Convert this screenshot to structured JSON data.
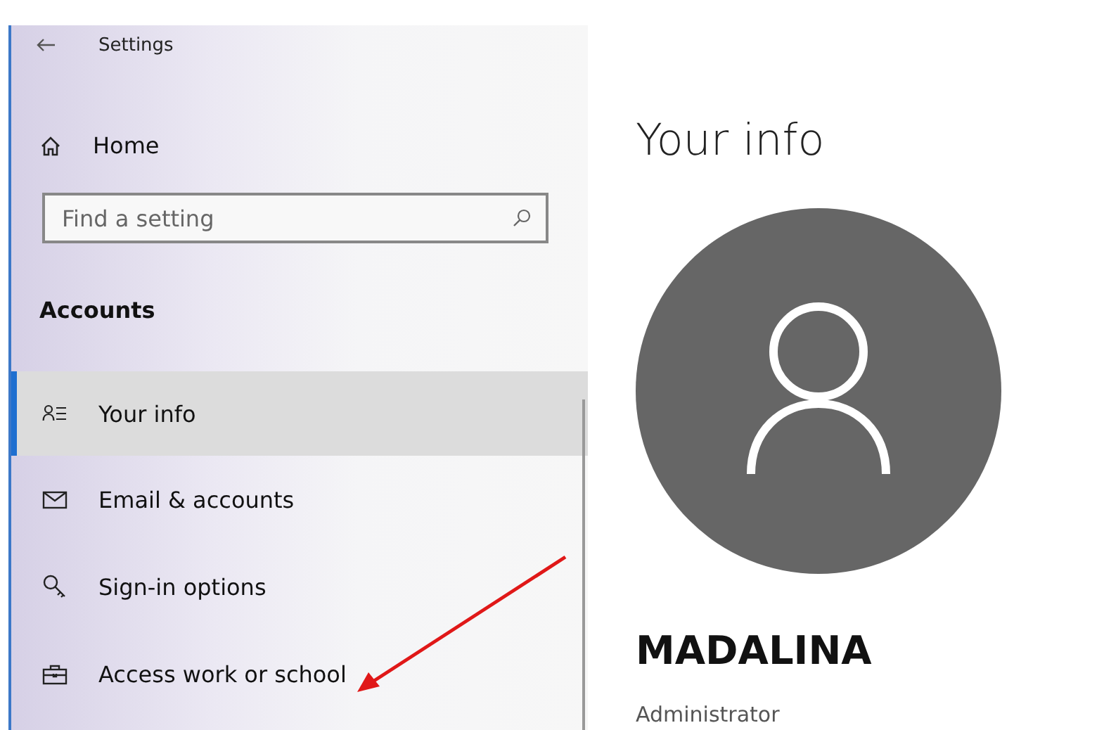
{
  "window": {
    "title": "Settings"
  },
  "sidebar": {
    "home": "Home",
    "search": {
      "placeholder": "Find a setting"
    },
    "section": "Accounts",
    "items": [
      {
        "label": "Your info",
        "selected": true
      },
      {
        "label": "Email & accounts",
        "selected": false
      },
      {
        "label": "Sign-in options",
        "selected": false
      },
      {
        "label": "Access work or school",
        "selected": false
      }
    ]
  },
  "content": {
    "heading": "Your info",
    "name": "MADALINA",
    "role": "Administrator"
  }
}
